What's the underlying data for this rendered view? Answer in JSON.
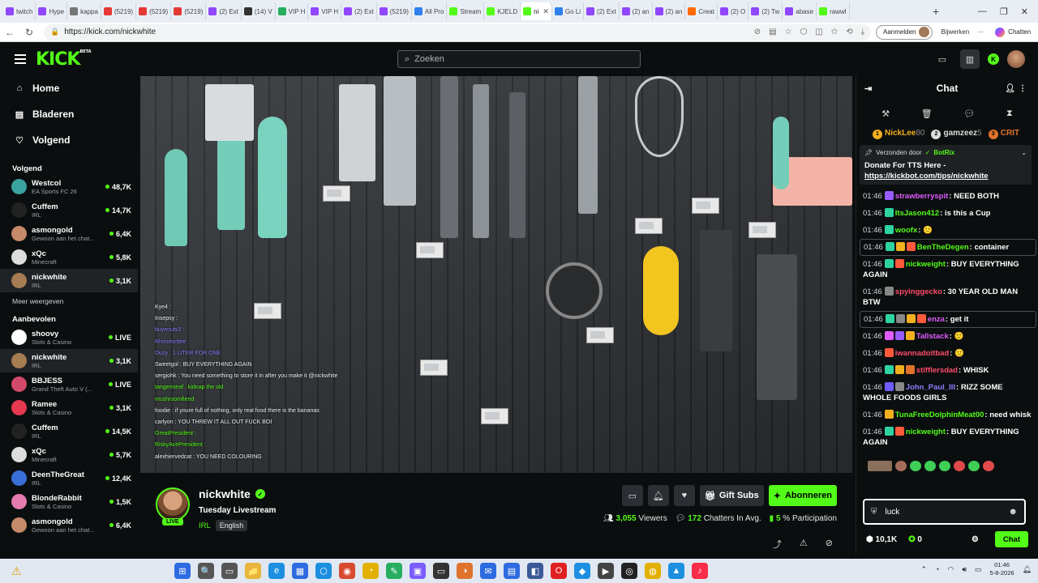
{
  "browser": {
    "tabs": [
      {
        "label": "twitch",
        "color": "#9146ff"
      },
      {
        "label": "Hype",
        "color": "#9146ff"
      },
      {
        "label": "kappa",
        "color": "#777777"
      },
      {
        "label": "(5219)",
        "color": "#e53935"
      },
      {
        "label": "(5219)",
        "color": "#e53935"
      },
      {
        "label": "(5219)",
        "color": "#e53935"
      },
      {
        "label": "(2) Ext",
        "color": "#9146ff"
      },
      {
        "label": "(14) V",
        "color": "#333333"
      },
      {
        "label": "VIP H",
        "color": "#27ae60"
      },
      {
        "label": "VIP H",
        "color": "#9146ff"
      },
      {
        "label": "(2) Ext",
        "color": "#9146ff"
      },
      {
        "label": "(5219)",
        "color": "#9146ff"
      },
      {
        "label": "All Pro",
        "color": "#2f80ed"
      },
      {
        "label": "Stream",
        "color": "#53fc18"
      },
      {
        "label": "KJELD",
        "color": "#53fc18"
      },
      {
        "label": "ni",
        "color": "#53fc18"
      },
      {
        "label": "Go Li",
        "color": "#2f80ed"
      },
      {
        "label": "(2) Ext",
        "color": "#9146ff"
      },
      {
        "label": "(2) an",
        "color": "#9146ff"
      },
      {
        "label": "(2) an",
        "color": "#9146ff"
      },
      {
        "label": "Creat",
        "color": "#ff6b00"
      },
      {
        "label": "(2) O",
        "color": "#9146ff"
      },
      {
        "label": "(2) Tw",
        "color": "#9146ff"
      },
      {
        "label": "abase",
        "color": "#9146ff"
      },
      {
        "label": "rawwl",
        "color": "#53fc18"
      }
    ],
    "active_tab_index": 15,
    "url": "https://kick.com/nickwhite",
    "signin_label": "Aanmelden",
    "updates_label": "Bijwerken",
    "copilot_label": "Chatten"
  },
  "kick": {
    "logo": "KICK",
    "logo_beta": "BETA",
    "search_placeholder": "Zoeken",
    "nav": [
      {
        "label": "Home",
        "icon": "⌂"
      },
      {
        "label": "Bladeren",
        "icon": "▤"
      },
      {
        "label": "Volgend",
        "icon": "♡"
      }
    ],
    "following_title": "Volgend",
    "following": [
      {
        "name": "Westcol",
        "category": "EA Sports FC 26",
        "viewers": "48,7K",
        "color": "#3aa3a0"
      },
      {
        "name": "Cuffem",
        "category": "IRL",
        "viewers": "14,7K",
        "color": "#222222"
      },
      {
        "name": "asmongold",
        "category": "Gewoon aan het chat...",
        "viewers": "6,4K",
        "color": "#c48a6a"
      },
      {
        "name": "xQc",
        "category": "Minecraft",
        "viewers": "5,8K",
        "color": "#dddddd"
      },
      {
        "name": "nickwhite",
        "category": "IRL",
        "viewers": "3,1K",
        "color": "#a67c52"
      }
    ],
    "show_more": "Meer weergeven",
    "recommended_title": "Aanbevolen",
    "recommended": [
      {
        "name": "shoovy",
        "category": "Slots & Casino",
        "viewers": "LIVE",
        "color": "#ffffff"
      },
      {
        "name": "nickwhite",
        "category": "IRL",
        "viewers": "3,1K",
        "color": "#a67c52"
      },
      {
        "name": "BBJESS",
        "category": "Grand Theft Auto V (...",
        "viewers": "LIVE",
        "color": "#d24a6a"
      },
      {
        "name": "Ramee",
        "category": "Slots & Casino",
        "viewers": "3,1K",
        "color": "#e53950"
      },
      {
        "name": "Cuffem",
        "category": "IRL",
        "viewers": "14,5K",
        "color": "#222222"
      },
      {
        "name": "xQc",
        "category": "Minecraft",
        "viewers": "5,7K",
        "color": "#dddddd"
      },
      {
        "name": "DeenTheGreat",
        "category": "IRL",
        "viewers": "12,4K",
        "color": "#3a6fd8"
      },
      {
        "name": "BlondeRabbit",
        "category": "Slots & Casino",
        "viewers": "1,5K",
        "color": "#e67bb0"
      },
      {
        "name": "asmongold",
        "category": "Gewoon aan het chat...",
        "viewers": "6,4K",
        "color": "#c48a6a"
      }
    ],
    "video_overlay": [
      {
        "text": "Kye4 :",
        "color": "#f2f2f2"
      },
      {
        "text": "Insepsy :",
        "color": "#f2f2f2"
      },
      {
        "text": "buyeouts3 :",
        "color": "#8f7cff"
      },
      {
        "text": "Rhinoforttee :",
        "color": "#8f7cff"
      },
      {
        "text": "Duzy : 1 LITER FOR ONE",
        "color": "#8f7cff"
      },
      {
        "text": "Sweetgol : BUY EVERYTHING AGAIN",
        "color": "#f2f2f2"
      },
      {
        "text": "sergiohk : You need something to store it in after you make it @nickwhite",
        "color": "#f2f2f2"
      },
      {
        "text": "tangerineaf : kidnap the old",
        "color": "#53fc18"
      },
      {
        "text": "mushroomfiend",
        "color": "#53fc18"
      },
      {
        "text": "foodie : if youre full of nothing, only real food there is the bananas",
        "color": "#f2f2f2"
      },
      {
        "text": "carlyon : YOU THREW IT ALL OUT FUCK BOI",
        "color": "#f2f2f2"
      },
      {
        "text": "GreatPresident :",
        "color": "#53fc18"
      },
      {
        "text": "RiskyAcePresident :",
        "color": "#53fc18"
      },
      {
        "text": "alexhiervedcat : YOU NEED COLOURING",
        "color": "#f2f2f2"
      }
    ],
    "streamer": {
      "name": "nickwhite",
      "title": "Tuesday Livestream",
      "category": "IRL",
      "language": "English",
      "live_label": "LIVE"
    },
    "actions": {
      "gift_subs": "Gift Subs",
      "subscribe": "Abonneren"
    },
    "stats": {
      "viewers_num": "3,055",
      "viewers_label": "Viewers",
      "chatters_num": "172",
      "chatters_label": "Chatters In Avg.",
      "participation_num": "5",
      "participation_label": "% Participation"
    },
    "chat": {
      "title": "Chat",
      "leaderboard": [
        {
          "name": "NickLee",
          "points": "80",
          "color": "#f2b01e"
        },
        {
          "name": "gamzeez",
          "points": "5",
          "color": "#dddddd"
        },
        {
          "name": "CRIT",
          "points": "",
          "color": "#e0732c"
        }
      ],
      "pinned_by_label": "Verzonden door",
      "pinned_by": "BotRix",
      "pinned_text": "Donate For TTS Here -",
      "pinned_link": "https://kickbot.com/tips/nickwhite",
      "messages": [
        {
          "time": "01:46",
          "user": "strawberryspit",
          "color": "#e05cff",
          "text": "NEED BOTH",
          "badges": [
            "#9a5cff"
          ],
          "hl": false
        },
        {
          "time": "01:46",
          "user": "ItsJason412",
          "color": "#53fc18",
          "text": "is this a Cup",
          "badges": [
            "#2ed3a0"
          ],
          "hl": false
        },
        {
          "time": "01:46",
          "user": "woofx",
          "color": "#53fc18",
          "text": "🙂",
          "badges": [
            "#2ed3a0"
          ],
          "hl": false
        },
        {
          "time": "01:46",
          "user": "BenTheDegen",
          "color": "#53fc18",
          "text": "container",
          "badges": [
            "#2ed3a0",
            "#f2b01e",
            "#ff5a3c"
          ],
          "hl": true
        },
        {
          "time": "01:46",
          "user": "nickweight",
          "color": "#53fc18",
          "text": "BUY EVERYTHING AGAIN",
          "badges": [
            "#2ed3a0",
            "#ff5a3c"
          ],
          "hl": false
        },
        {
          "time": "01:46",
          "user": "spyinggecko",
          "color": "#ff4d6a",
          "text": "30 YEAR OLD MAN BTW",
          "badges": [
            "#888888"
          ],
          "hl": false
        },
        {
          "time": "01:46",
          "user": "enza",
          "color": "#e05cff",
          "text": "get it",
          "badges": [
            "#2ed3a0",
            "#888888",
            "#f2b01e",
            "#ff5a3c"
          ],
          "hl": true
        },
        {
          "time": "01:46",
          "user": "Tallstack",
          "color": "#e05cff",
          "text": "🙂",
          "badges": [
            "#e05cff",
            "#9a5cff",
            "#f2b01e"
          ],
          "hl": false
        },
        {
          "time": "01:46",
          "user": "iwannadoitbad",
          "color": "#ff4d6a",
          "text": "🙂",
          "badges": [
            "#ff5a3c"
          ],
          "hl": false
        },
        {
          "time": "01:46",
          "user": "stifflersdad",
          "color": "#ff4d6a",
          "text": "WHISK",
          "badges": [
            "#2ed3a0",
            "#f2b01e",
            "#e0732c"
          ],
          "hl": false
        },
        {
          "time": "01:46",
          "user": "John_Paul_III",
          "color": "#8f7cff",
          "text": "RIZZ SOME WHOLE FOODS GIRLS",
          "badges": [
            "#6f5cff",
            "#888888"
          ],
          "hl": false
        },
        {
          "time": "01:46",
          "user": "TunaFreeDolphinMeat00",
          "color": "#53fc18",
          "text": "need whisk",
          "badges": [
            "#f2b01e"
          ],
          "hl": false
        },
        {
          "time": "01:46",
          "user": "nickweight",
          "color": "#53fc18",
          "text": "BUY EVERYTHING AGAIN",
          "badges": [
            "#2ed3a0",
            "#ff5a3c"
          ],
          "hl": false
        }
      ],
      "input_value": "luck",
      "points": "10,1K",
      "kick_points": "0",
      "send_label": "Chat"
    }
  },
  "taskbar": {
    "apps": [
      {
        "icon": "⊞",
        "color": "#2d6be0"
      },
      {
        "icon": "🔍",
        "color": "#555555"
      },
      {
        "icon": "▭",
        "color": "#555555"
      },
      {
        "icon": "📁",
        "color": "#e9b63b"
      },
      {
        "icon": "e",
        "color": "#1d8fe1"
      },
      {
        "icon": "▦",
        "color": "#2d6be0"
      },
      {
        "icon": "⬡",
        "color": "#1d8fe1"
      },
      {
        "icon": "◉",
        "color": "#d84a30"
      },
      {
        "icon": "◔",
        "color": "#e2b100"
      },
      {
        "icon": "✎",
        "color": "#27ae60"
      },
      {
        "icon": "▣",
        "color": "#7a5cff"
      },
      {
        "icon": "▭",
        "color": "#333333"
      },
      {
        "icon": "◑",
        "color": "#e0732c"
      },
      {
        "icon": "✉",
        "color": "#2d6be0"
      },
      {
        "icon": "▤",
        "color": "#2d6be0"
      },
      {
        "icon": "◧",
        "color": "#3b5998"
      },
      {
        "icon": "O",
        "color": "#e02020"
      },
      {
        "icon": "◆",
        "color": "#1d8fe1"
      },
      {
        "icon": "▶",
        "color": "#444444"
      },
      {
        "icon": "◎",
        "color": "#222222"
      },
      {
        "icon": "◍",
        "color": "#e2b100"
      },
      {
        "icon": "▲",
        "color": "#1d8fe1"
      },
      {
        "icon": "♪",
        "color": "#fa2d48"
      }
    ],
    "time": "01:46",
    "date": "5-8-2026"
  }
}
